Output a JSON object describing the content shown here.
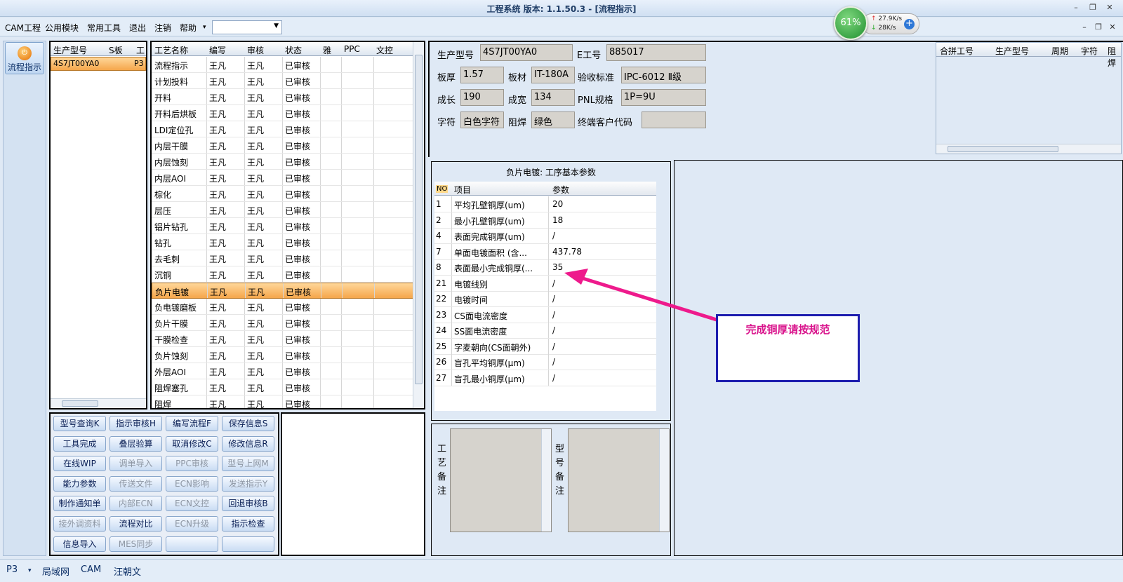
{
  "window": {
    "title": "工程系统  版本: 1.1.50.3 - [流程指示]"
  },
  "menu": [
    "CAM工程",
    "公用模块",
    "常用工具",
    "退出",
    "注销",
    "帮助"
  ],
  "speed": {
    "percent": "61%",
    "up": "27.9K/s",
    "down": "28K/s"
  },
  "leftstrip": {
    "flow_label": "流程指示"
  },
  "left_grid": {
    "headers": [
      "生产型号",
      "S板",
      "工"
    ],
    "rows": [
      [
        "4S7JT00YA0",
        "P3"
      ]
    ]
  },
  "process_grid": {
    "headers": [
      "工艺名称",
      "编写",
      "审核",
      "状态",
      "雅",
      "PPC",
      "文控"
    ],
    "rows": [
      [
        "流程指示",
        "王凡",
        "王凡",
        "已审核"
      ],
      [
        "计划投料",
        "王凡",
        "王凡",
        "已审核"
      ],
      [
        "开料",
        "王凡",
        "王凡",
        "已审核"
      ],
      [
        "开料后烘板",
        "王凡",
        "王凡",
        "已审核"
      ],
      [
        "LDI定位孔",
        "王凡",
        "王凡",
        "已审核"
      ],
      [
        "内层干膜",
        "王凡",
        "王凡",
        "已审核"
      ],
      [
        "内层蚀刻",
        "王凡",
        "王凡",
        "已审核"
      ],
      [
        "内层AOI",
        "王凡",
        "王凡",
        "已审核"
      ],
      [
        "棕化",
        "王凡",
        "王凡",
        "已审核"
      ],
      [
        "层压",
        "王凡",
        "王凡",
        "已审核"
      ],
      [
        "铝片钻孔",
        "王凡",
        "王凡",
        "已审核"
      ],
      [
        "钻孔",
        "王凡",
        "王凡",
        "已审核"
      ],
      [
        "去毛刺",
        "王凡",
        "王凡",
        "已审核"
      ],
      [
        "沉铜",
        "王凡",
        "王凡",
        "已审核"
      ],
      [
        "负片电镀",
        "王凡",
        "王凡",
        "已审核"
      ],
      [
        "负电镀磨板",
        "王凡",
        "王凡",
        "已审核"
      ],
      [
        "负片干膜",
        "王凡",
        "王凡",
        "已审核"
      ],
      [
        "干膜检查",
        "王凡",
        "王凡",
        "已审核"
      ],
      [
        "负片蚀刻",
        "王凡",
        "王凡",
        "已审核"
      ],
      [
        "外层AOI",
        "王凡",
        "王凡",
        "已审核"
      ],
      [
        "阻焊塞孔",
        "王凡",
        "王凡",
        "已审核"
      ],
      [
        "阻焊",
        "王凡",
        "王凡",
        "已审核"
      ]
    ],
    "selected_index": 14
  },
  "buttons": [
    [
      "型号查询K",
      "指示审核H",
      "编写流程F",
      "保存信息S"
    ],
    [
      "工具完成",
      "叠层验算",
      "取消修改C",
      "修改信息R"
    ],
    [
      "在线WIP",
      "调单导入",
      "PPC审核",
      "型号上网M"
    ],
    [
      "能力参数",
      "传送文件",
      "ECN影响",
      "发送指示Y"
    ],
    [
      "制作通知单",
      "内部ECN",
      "ECN文控",
      "回退审核B"
    ],
    [
      "接外调资料",
      "流程对比",
      "ECN升级",
      "指示检查"
    ],
    [
      "信息导入",
      "MES同步",
      "",
      ""
    ]
  ],
  "disabled_buttons": [
    "调单导入",
    "PPC审核",
    "型号上网M",
    "传送文件",
    "ECN影响",
    "发送指示Y",
    "内部ECN",
    "ECN文控",
    "接外调资料",
    "ECN升级",
    "MES同步"
  ],
  "info": {
    "model_label": "生产型号",
    "model": "4S7JT00YA0",
    "eno_label": "E工号",
    "eno": "885017",
    "thick_label": "板厚",
    "thick": "1.57",
    "material_label": "板材",
    "material": "IT-180A",
    "std_label": "验收标准",
    "std": "IPC-6012 Ⅱ级",
    "len_label": "成长",
    "len": "190",
    "wid_label": "成宽",
    "wid": "134",
    "pnl_label": "PNL规格",
    "pnl": "1P=9U",
    "char_label": "字符",
    "char": "白色字符",
    "mask_label": "阻焊",
    "mask": "绿色",
    "cust_label": "终端客户代码",
    "cust": ""
  },
  "merge_grid": {
    "headers": [
      "合拼工号",
      "生产型号",
      "周期",
      "字符",
      "阻焊"
    ]
  },
  "params": {
    "title": "负片电镀: 工序基本参数",
    "headers": [
      "NO",
      "项目",
      "参数"
    ],
    "rows": [
      [
        "1",
        "平均孔壁铜厚(um)",
        "20"
      ],
      [
        "2",
        "最小孔壁铜厚(um)",
        "18"
      ],
      [
        "4",
        "表面完成铜厚(um)",
        "/"
      ],
      [
        "7",
        "单面电镀面积 (含...",
        "437.78"
      ],
      [
        "8",
        "表面最小完成铜厚(...",
        "35"
      ],
      [
        "21",
        "电镀线别",
        "/"
      ],
      [
        "22",
        "电镀时间",
        "/"
      ],
      [
        "23",
        "CS面电流密度",
        "/"
      ],
      [
        "24",
        "SS面电流密度",
        "/"
      ],
      [
        "25",
        "字麦朝向(CS面朝外)",
        "/"
      ],
      [
        "26",
        "盲孔平均铜厚(μm)",
        "/"
      ],
      [
        "27",
        "盲孔最小铜厚(μm)",
        "/"
      ]
    ]
  },
  "notes": {
    "process_label": "工艺备注",
    "model_label": "型号备注"
  },
  "status": {
    "p3": "P3",
    "lan": "局域网",
    "cam": "CAM",
    "user": "汪朝文"
  },
  "callout": {
    "text": "完成铜厚请按规范"
  },
  "colors": {
    "accent": "#f5a64b",
    "arrow": "#ee1a8c",
    "callout_border": "#1d1dae"
  }
}
